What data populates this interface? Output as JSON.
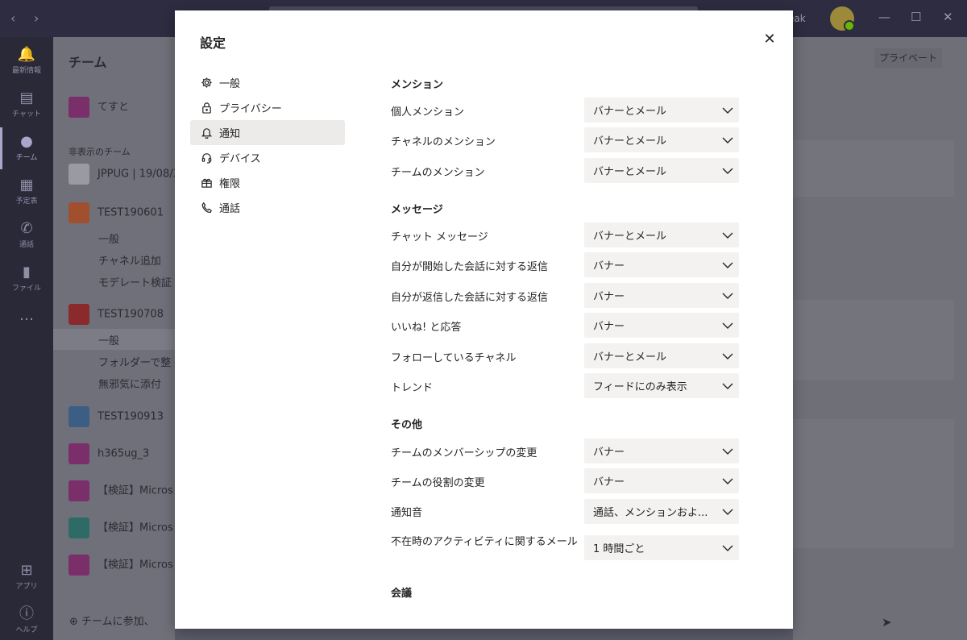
{
  "app": {
    "user_name_fragment": "eak",
    "rail": [
      {
        "label": "最新情報",
        "icon": "bell-icon"
      },
      {
        "label": "チャット",
        "icon": "chat-icon"
      },
      {
        "label": "チーム",
        "icon": "teams-icon"
      },
      {
        "label": "予定表",
        "icon": "calendar-icon"
      },
      {
        "label": "通話",
        "icon": "phone-icon"
      },
      {
        "label": "ファイル",
        "icon": "file-icon"
      },
      {
        "label": "…",
        "icon": "more-icon"
      },
      {
        "label": "アプリ",
        "icon": "apps-icon"
      },
      {
        "label": "ヘルプ",
        "icon": "help-icon"
      }
    ],
    "teams_pane": {
      "title": "チーム",
      "pinned_team": "てすと",
      "hidden_section": "非表示のチーム",
      "teams": [
        {
          "name": "JPPUG | 19/08/3",
          "color": "#9a9aa2",
          "initial": ""
        },
        {
          "name": "TEST190601",
          "color": "#a0502e",
          "initial": "T"
        },
        {
          "name": "TEST190708",
          "color": "#8a2a2a",
          "initial": "T"
        },
        {
          "name": "TEST190913",
          "color": "#3b5e84",
          "initial": "T"
        },
        {
          "name": "h365ug_3",
          "color": "#7a2e6a",
          "initial": "h3"
        },
        {
          "name": "【検証】Micros",
          "color": "#7a2e6a",
          "initial": "TP"
        },
        {
          "name": "【検証】Micros",
          "color": "#2f6b66",
          "initial": "MT"
        },
        {
          "name": "【検証】Micros",
          "color": "#7a2e6a",
          "initial": "MT"
        }
      ],
      "channels_190601": [
        "一般",
        "チャネル追加",
        "モデレート検証"
      ],
      "channels_190708": [
        "一般",
        "フォルダーで整",
        "無邪気に添付"
      ],
      "join_label": "チームに参加、"
    },
    "right_private_button": "プライベート"
  },
  "settings": {
    "title": "設定",
    "close_icon": "close-icon",
    "menu": [
      {
        "label": "一般",
        "icon": "gear-icon"
      },
      {
        "label": "プライバシー",
        "icon": "lock-icon"
      },
      {
        "label": "通知",
        "icon": "bell-icon",
        "active": true
      },
      {
        "label": "デバイス",
        "icon": "headset-icon"
      },
      {
        "label": "権限",
        "icon": "gift-box-icon"
      },
      {
        "label": "通話",
        "icon": "phone-icon"
      }
    ],
    "sections": {
      "mentions": "メンション",
      "messages": "メッセージ",
      "other": "その他",
      "meetings": "会議"
    },
    "rows": [
      {
        "label": "個人メンション",
        "value": "バナーとメール"
      },
      {
        "label": "チャネルのメンション",
        "value": "バナーとメール"
      },
      {
        "label": "チームのメンション",
        "value": "バナーとメール"
      },
      {
        "label": "チャット メッセージ",
        "value": "バナーとメール"
      },
      {
        "label": "自分が開始した会話に対する返信",
        "value": "バナー"
      },
      {
        "label": "自分が返信した会話に対する返信",
        "value": "バナー"
      },
      {
        "label": "いいね! と応答",
        "value": "バナー"
      },
      {
        "label": "フォローしているチャネル",
        "value": "バナーとメール"
      },
      {
        "label": "トレンド",
        "value": "フィードにのみ表示"
      },
      {
        "label": "チームのメンバーシップの変更",
        "value": "バナー"
      },
      {
        "label": "チームの役割の変更",
        "value": "バナー"
      },
      {
        "label": "通知音",
        "value": "通話、メンションおよ..."
      },
      {
        "label": "不在時のアクティビティに関するメール",
        "value": "1 時間ごと"
      }
    ]
  }
}
